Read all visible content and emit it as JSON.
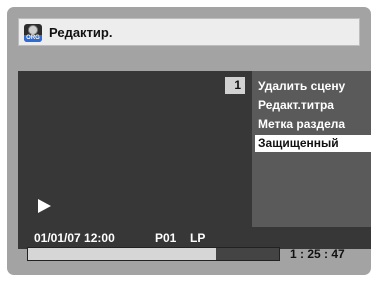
{
  "header": {
    "title": "Редактир.",
    "disc_icon_label": "ORG"
  },
  "preview": {
    "scene_number": "1",
    "play_icon": "play-icon"
  },
  "menu": {
    "items": [
      {
        "label": "Удалить сцену",
        "selected": false
      },
      {
        "label": "Редакт.титра",
        "selected": false
      },
      {
        "label": "Метка раздела",
        "selected": false
      },
      {
        "label": "Защищенный",
        "selected": true
      }
    ]
  },
  "info": {
    "datetime": "01/01/07 12:00",
    "program": "P01",
    "mode": "LP"
  },
  "playback": {
    "progress_fraction": 0.75,
    "time": "1 : 25 : 47"
  },
  "colors": {
    "panel": "#a3a3a3",
    "preview_bg": "#373737",
    "menu_bg": "#5a5a5a",
    "highlight": "#ffffff"
  }
}
